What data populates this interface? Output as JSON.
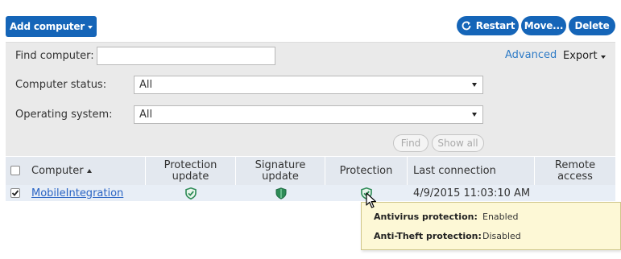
{
  "toolbar": {
    "add_computer": "Add computer",
    "restart": "Restart",
    "move": "Move...",
    "delete": "Delete"
  },
  "filters": {
    "find_label": "Find computer:",
    "find_value": "",
    "advanced": "Advanced",
    "export": "Export",
    "status_label": "Computer status:",
    "status_value": "All",
    "os_label": "Operating system:",
    "os_value": "All",
    "find_button": "Find",
    "show_all_button": "Show all"
  },
  "table": {
    "columns": {
      "computer": "Computer",
      "protection_update": "Protection update",
      "signature_update": "Signature update",
      "protection": "Protection",
      "last_connection": "Last connection",
      "remote_access": "Remote access"
    },
    "rows": [
      {
        "checked": true,
        "computer": "MobileIntegration",
        "last_connection": "4/9/2015 11:03:10 AM"
      }
    ]
  },
  "tooltip": {
    "antivirus_label": "Antivirus protection:",
    "antivirus_value": "Enabled",
    "antitheft_label": "Anti-Theft protection:",
    "antitheft_value": "Disabled"
  },
  "colors": {
    "primary": "#1565b8",
    "shield_green": "#2e8b57",
    "header_bg": "#e3e8ef",
    "tooltip_bg": "#fdf8d6"
  }
}
